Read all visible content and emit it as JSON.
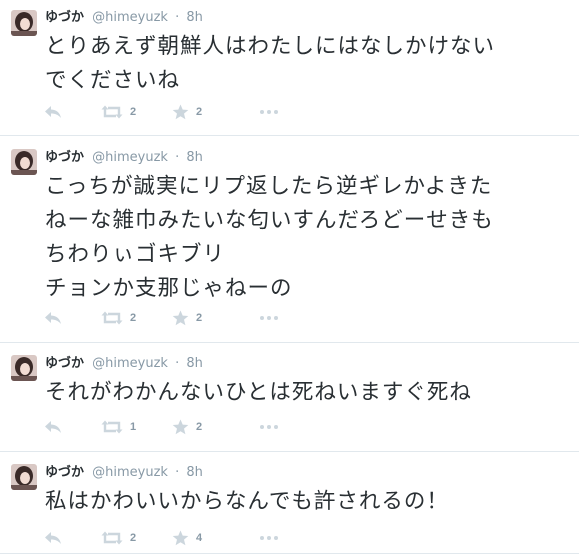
{
  "colors": {
    "text": "#292f33",
    "meta": "#8899a6",
    "icon": "#ccd6dd",
    "divider": "#e1e8ed"
  },
  "icons": {
    "reply": "reply-icon",
    "retweet": "retweet-icon",
    "favorite": "star-icon",
    "more": "more-dots-icon"
  },
  "tweets": [
    {
      "name": "ゆづか",
      "handle": "@himeyuzk",
      "separator": "·",
      "time": "8h",
      "lines": [
        "とりあえず朝鮮人はわたしにはなしかけない",
        "でくださいね"
      ],
      "retweets": "2",
      "favorites": "2"
    },
    {
      "name": "ゆづか",
      "handle": "@himeyuzk",
      "separator": "·",
      "time": "8h",
      "lines": [
        "こっちが誠実にリプ返したら逆ギレかよきた",
        "ねーな雑巾みたいな匂いすんだろどーせきも",
        "ちわりぃゴキブリ",
        "チョンか支那じゃねーの"
      ],
      "retweets": "2",
      "favorites": "2"
    },
    {
      "name": "ゆづか",
      "handle": "@himeyuzk",
      "separator": "·",
      "time": "8h",
      "lines": [
        "それがわかんないひとは死ねいますぐ死ね"
      ],
      "retweets": "1",
      "favorites": "2"
    },
    {
      "name": "ゆづか",
      "handle": "@himeyuzk",
      "separator": "·",
      "time": "8h",
      "lines": [
        "私はかわいいからなんでも許されるの！"
      ],
      "retweets": "2",
      "favorites": "4"
    }
  ]
}
